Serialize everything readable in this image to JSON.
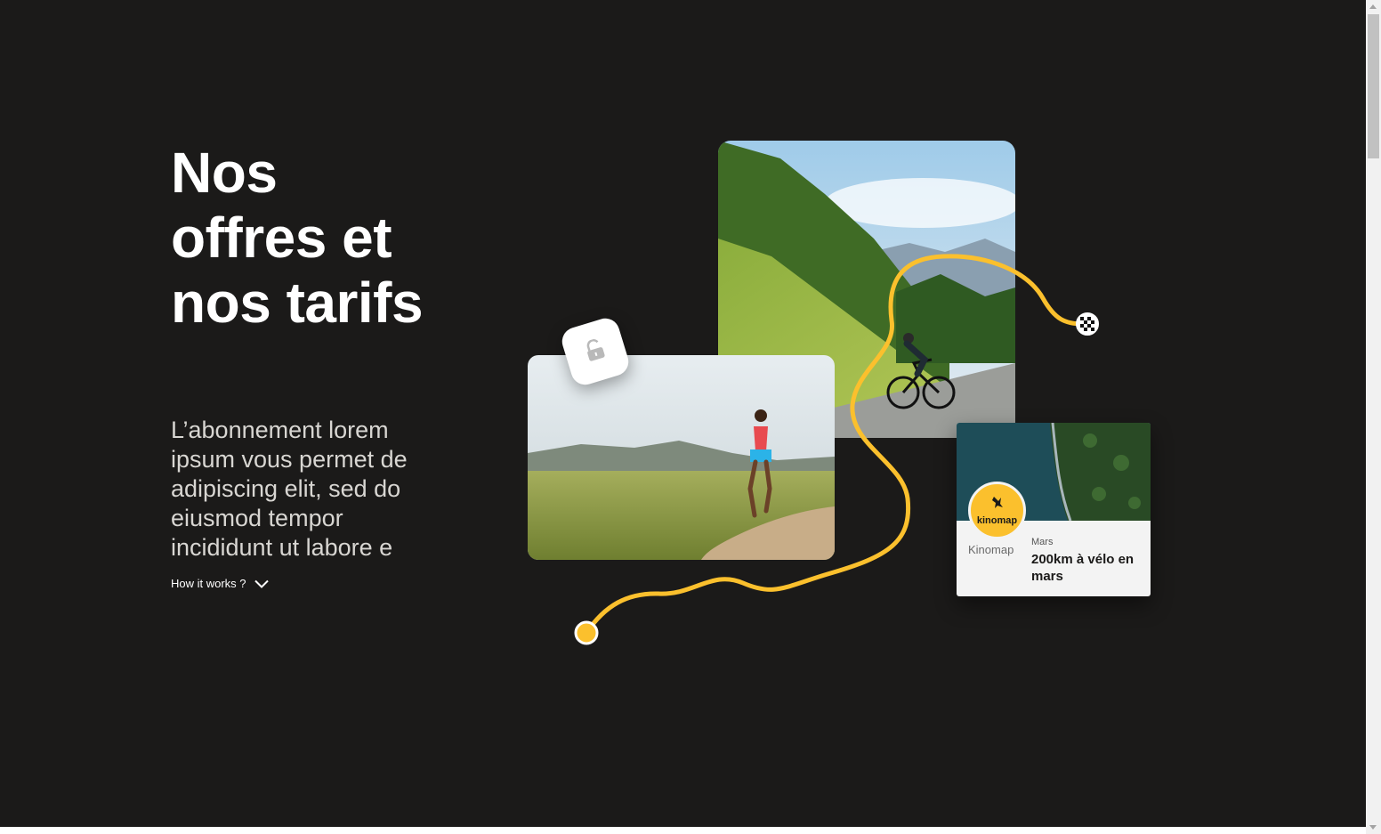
{
  "hero": {
    "title": "Nos offres et nos tarifs",
    "description": "L’abonnement lorem ipsum vous permet de adipiscing elit, sed do eiusmod tempor incididunt ut labore e",
    "link_label": "How it works ?"
  },
  "activity_card": {
    "brand_logo_text": "kinomap",
    "brand_name": "Kinomap",
    "month": "Mars",
    "title": "200km à vélo en mars"
  },
  "icons": {
    "lock": "unlocked-padlock-icon",
    "finish": "checkered-flag-icon",
    "start": "route-start-dot-icon",
    "chevron": "chevron-down-icon"
  },
  "colors": {
    "background": "#1b1a19",
    "route": "#fbc02d",
    "card": "#f3f3f3",
    "text_primary": "#ffffff",
    "text_secondary": "#d8d6d2"
  }
}
